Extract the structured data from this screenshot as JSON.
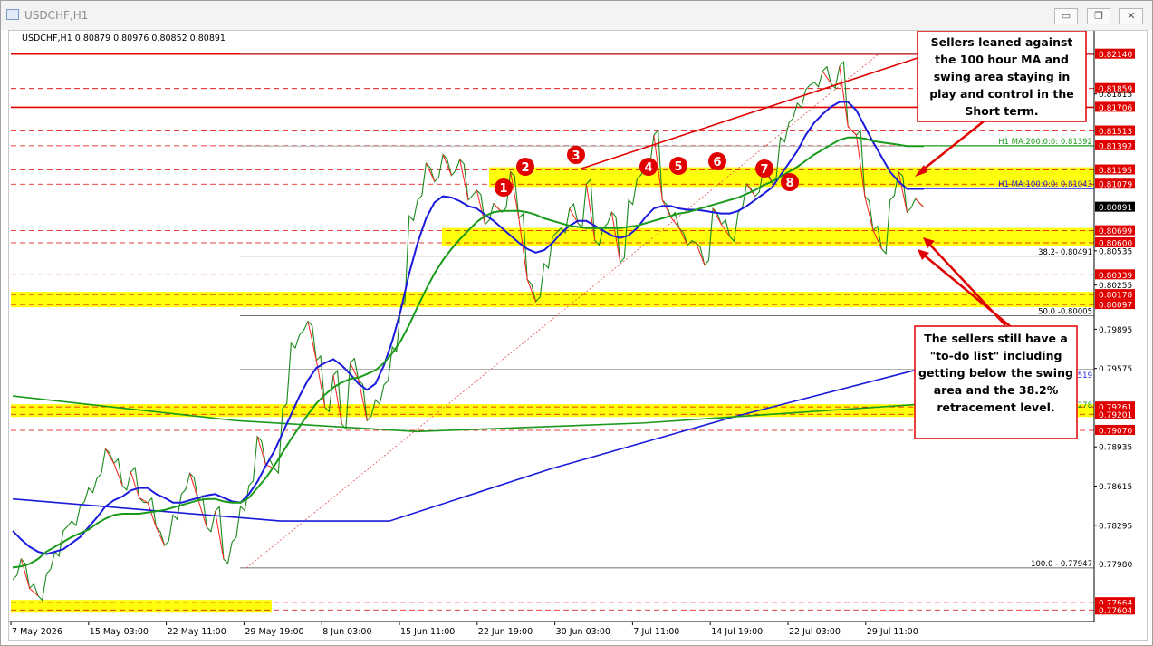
{
  "window": {
    "title": "USDCHF,H1",
    "minimize_glyph": "▭",
    "restore_glyph": "❐",
    "close_glyph": "✕"
  },
  "colors": {
    "price_line_up": "#1a8a1a",
    "price_line_down": "#ff2020",
    "ma100": "#1a1adc",
    "ma200": "#1a9a1a",
    "zone": "#ffff00",
    "level_line": "#e00000",
    "annotation_border": "#e00000"
  },
  "chart_data": {
    "type": "line",
    "symbol": "USDCHF,H1",
    "info_line": "USDCHF,H1  0.80879 0.80976 0.80852 0.80891",
    "ylim": [
      0.7751,
      0.8233
    ],
    "x_ticks": [
      "7 May 2026",
      "15 May 03:00",
      "22 May 11:00",
      "29 May 19:00",
      "8 Jun 03:00",
      "15 Jun 11:00",
      "22 Jun 19:00",
      "30 Jun 03:00",
      "7 Jul 11:00",
      "14 Jul 19:00",
      "22 Jul 03:00",
      "29 Jul 11:00"
    ],
    "price_labels": [
      {
        "text": "0.82140",
        "value": 0.8214,
        "highlight": true
      },
      {
        "text": "0.81859",
        "value": 0.81859,
        "highlight": true
      },
      {
        "text": "0.81815",
        "value": 0.81815,
        "highlight": false
      },
      {
        "text": "0.81706",
        "value": 0.81706,
        "highlight": true
      },
      {
        "text": "0.81513",
        "value": 0.81513,
        "highlight": true
      },
      {
        "text": "0.81392",
        "value": 0.81392,
        "highlight": true
      },
      {
        "text": "0.81195",
        "value": 0.81195,
        "highlight": true
      },
      {
        "text": "0.81079",
        "value": 0.81079,
        "highlight": true
      },
      {
        "text": "0.80891",
        "value": 0.80891,
        "current": true
      },
      {
        "text": "0.80699",
        "value": 0.80699,
        "highlight": true
      },
      {
        "text": "0.80600",
        "value": 0.806,
        "highlight": true
      },
      {
        "text": "0.80535",
        "value": 0.80535,
        "highlight": false
      },
      {
        "text": "0.80339",
        "value": 0.80339,
        "highlight": true
      },
      {
        "text": "0.80255",
        "value": 0.80255,
        "highlight": false
      },
      {
        "text": "0.80178",
        "value": 0.80178,
        "highlight": true
      },
      {
        "text": "0.80097",
        "value": 0.80097,
        "highlight": true
      },
      {
        "text": "0.79895",
        "value": 0.79895,
        "highlight": false
      },
      {
        "text": "0.79575",
        "value": 0.79575,
        "highlight": false
      },
      {
        "text": "0.79261",
        "value": 0.79261,
        "highlight": true
      },
      {
        "text": "0.79201",
        "value": 0.79201,
        "highlight": true
      },
      {
        "text": "0.79070",
        "value": 0.7907,
        "highlight": true
      },
      {
        "text": "0.78935",
        "value": 0.78935,
        "highlight": false
      },
      {
        "text": "0.78615",
        "value": 0.78615,
        "highlight": false
      },
      {
        "text": "0.78295",
        "value": 0.78295,
        "highlight": false
      },
      {
        "text": "0.77980",
        "value": 0.7798,
        "highlight": false
      },
      {
        "text": "0.77664",
        "value": 0.77664,
        "highlight": true
      },
      {
        "text": "0.77604",
        "value": 0.77604,
        "highlight": true
      }
    ],
    "zones": [
      {
        "from": 0.81079,
        "to": 0.81195
      },
      {
        "from": 0.806,
        "to": 0.80699
      },
      {
        "from": 0.80097,
        "to": 0.80178
      },
      {
        "from": 0.79201,
        "to": 0.79261
      },
      {
        "from": 0.77604,
        "to": 0.77664
      }
    ],
    "fib_levels": [
      {
        "text": "38.2- 0.80491",
        "value": 0.80491
      },
      {
        "text": "50.0 -0.80005",
        "value": 0.80005
      },
      {
        "text": "100.0 - 0.77947",
        "value": 0.77947
      }
    ],
    "ma_labels": [
      {
        "text": "H1 MA:200:0:0: 0.81392",
        "value": 0.81392
      },
      {
        "text": "H1 MA:100:0:0: 0.81043",
        "value": 0.81043
      }
    ],
    "right_labels": [
      {
        "text": "0.79519",
        "value": 0.79519
      },
      {
        "text": "0.79278",
        "value": 0.79278
      }
    ],
    "markers": [
      "1",
      "2",
      "3",
      "4",
      "5",
      "6",
      "7",
      "8"
    ],
    "price": [
      0.7785,
      0.7802,
      0.7778,
      0.7772,
      0.779,
      0.7808,
      0.7825,
      0.7833,
      0.7845,
      0.786,
      0.7868,
      0.7892,
      0.788,
      0.7862,
      0.7873,
      0.7852,
      0.7848,
      0.7828,
      0.7813,
      0.7838,
      0.7855,
      0.7872,
      0.785,
      0.7828,
      0.7841,
      0.7802,
      0.7816,
      0.7845,
      0.7862,
      0.7902,
      0.7879,
      0.7876,
      0.7925,
      0.7978,
      0.7985,
      0.7996,
      0.7964,
      0.7926,
      0.7952,
      0.7912,
      0.7962,
      0.7948,
      0.7915,
      0.7932,
      0.7944,
      0.7975,
      0.8008,
      0.8082,
      0.8095,
      0.8125,
      0.811,
      0.8132,
      0.8115,
      0.8128,
      0.8095,
      0.8103,
      0.8075,
      0.8092,
      0.8085,
      0.8118,
      0.808,
      0.803,
      0.8012,
      0.8043,
      0.8065,
      0.8072,
      0.8088,
      0.8076,
      0.8108,
      0.8062,
      0.8072,
      0.8085,
      0.8044,
      0.8095,
      0.8112,
      0.8125,
      0.8148,
      0.8095,
      0.8081,
      0.8072,
      0.8058,
      0.806,
      0.8042,
      0.8088,
      0.8075,
      0.8065,
      0.8085,
      0.8108,
      0.8098,
      0.8121,
      0.8109,
      0.8146,
      0.8158,
      0.8174,
      0.8185,
      0.8191,
      0.82,
      0.819,
      0.8204,
      0.8155,
      0.8148,
      0.8098,
      0.807,
      0.8055,
      0.8095,
      0.8118,
      0.8085,
      0.8096,
      0.8089
    ],
    "ma100": [
      0.7825,
      0.7818,
      0.7812,
      0.7808,
      0.7806,
      0.7808,
      0.781,
      0.7815,
      0.782,
      0.7828,
      0.7836,
      0.7845,
      0.785,
      0.7853,
      0.7858,
      0.786,
      0.786,
      0.7855,
      0.7852,
      0.7848,
      0.7848,
      0.785,
      0.7852,
      0.7854,
      0.7855,
      0.7852,
      0.7849,
      0.7848,
      0.7855,
      0.7865,
      0.7878,
      0.789,
      0.7905,
      0.792,
      0.7935,
      0.7948,
      0.7958,
      0.7962,
      0.7965,
      0.796,
      0.7953,
      0.7945,
      0.794,
      0.7945,
      0.796,
      0.798,
      0.8005,
      0.8035,
      0.806,
      0.808,
      0.8093,
      0.8098,
      0.8097,
      0.8094,
      0.809,
      0.8088,
      0.8083,
      0.8078,
      0.8072,
      0.8066,
      0.806,
      0.8055,
      0.8052,
      0.8054,
      0.806,
      0.8068,
      0.8074,
      0.8078,
      0.8078,
      0.8074,
      0.807,
      0.8066,
      0.8064,
      0.8066,
      0.8072,
      0.8081,
      0.8088,
      0.809,
      0.809,
      0.8088,
      0.8087,
      0.8087,
      0.8086,
      0.8085,
      0.8084,
      0.8084,
      0.8086,
      0.809,
      0.8095,
      0.81,
      0.8105,
      0.8115,
      0.8125,
      0.8135,
      0.8148,
      0.8158,
      0.8165,
      0.8171,
      0.8175,
      0.8175,
      0.8168,
      0.8155,
      0.8142,
      0.813,
      0.8118,
      0.811,
      0.8104,
      0.8104,
      0.8104
    ],
    "ma200": [
      0.7795,
      0.7796,
      0.7798,
      0.7802,
      0.7808,
      0.7812,
      0.7816,
      0.782,
      0.7823,
      0.7826,
      0.7831,
      0.7835,
      0.7838,
      0.7839,
      0.7839,
      0.7839,
      0.784,
      0.7841,
      0.7842,
      0.7844,
      0.7846,
      0.7848,
      0.785,
      0.7851,
      0.7851,
      0.7849,
      0.7848,
      0.7848,
      0.7852,
      0.786,
      0.7868,
      0.7878,
      0.7889,
      0.79,
      0.791,
      0.792,
      0.7929,
      0.7936,
      0.7942,
      0.7946,
      0.7949,
      0.795,
      0.7953,
      0.7956,
      0.7962,
      0.797,
      0.798,
      0.7993,
      0.8008,
      0.8022,
      0.8035,
      0.8046,
      0.8055,
      0.8063,
      0.807,
      0.8077,
      0.8082,
      0.8085,
      0.8086,
      0.8086,
      0.8086,
      0.8085,
      0.8083,
      0.808,
      0.8078,
      0.8076,
      0.8074,
      0.8073,
      0.8072,
      0.8072,
      0.8072,
      0.8072,
      0.8072,
      0.8073,
      0.8074,
      0.8076,
      0.8078,
      0.808,
      0.8082,
      0.8084,
      0.8085,
      0.8087,
      0.8089,
      0.8091,
      0.8093,
      0.8095,
      0.8097,
      0.81,
      0.8103,
      0.8107,
      0.811,
      0.8114,
      0.8118,
      0.8122,
      0.8127,
      0.8132,
      0.8136,
      0.814,
      0.8144,
      0.8146,
      0.8146,
      0.8145,
      0.8143,
      0.8142,
      0.8141,
      0.814,
      0.8139,
      0.8139,
      0.8139
    ]
  },
  "annotations": {
    "top_box": "Sellers leaned against the 100 hour MA and swing area staying in play and control in the Short term.",
    "bottom_box": "The sellers still have a \"to-do list\" including getting below the swing area and the 38.2% retracement level."
  }
}
